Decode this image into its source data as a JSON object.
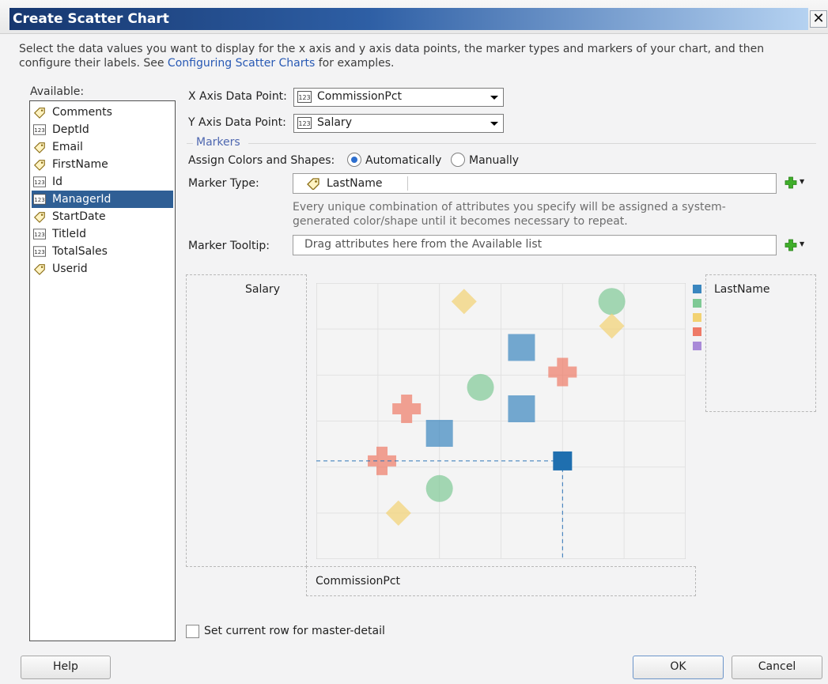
{
  "dialog": {
    "title": "Create Scatter Chart",
    "close_glyph": "✕",
    "description_before_link": "Select the data values you want to display for the x axis and y axis data points, the marker types and markers of your chart, and then configure their labels. See",
    "description_link": "Configuring Scatter Charts",
    "description_after_link": "for examples."
  },
  "available": {
    "label": "Available:",
    "selected_index": 5,
    "items": [
      {
        "label": "Comments",
        "icon": "tag-icon"
      },
      {
        "label": "DeptId",
        "icon": "number-icon"
      },
      {
        "label": "Email",
        "icon": "tag-icon"
      },
      {
        "label": "FirstName",
        "icon": "tag-icon"
      },
      {
        "label": "Id",
        "icon": "number-icon"
      },
      {
        "label": "ManagerId",
        "icon": "number-icon"
      },
      {
        "label": "StartDate",
        "icon": "tag-icon"
      },
      {
        "label": "TitleId",
        "icon": "number-icon"
      },
      {
        "label": "TotalSales",
        "icon": "number-icon"
      },
      {
        "label": "Userid",
        "icon": "tag-icon"
      }
    ]
  },
  "fields": {
    "x_axis": {
      "label": "X Axis Data Point:",
      "value": "CommissionPct"
    },
    "y_axis": {
      "label": "Y Axis Data Point:",
      "value": "Salary"
    },
    "markers_section": "Markers",
    "assign_label": "Assign Colors and Shapes:",
    "assign_options": [
      "Automatically",
      "Manually"
    ],
    "assign_selected": "Automatically",
    "marker_type": {
      "label": "Marker Type:",
      "value": "LastName"
    },
    "marker_type_hint": "Every unique combination of attributes you specify will be assigned a system-generated color/shape until it becomes necessary to repeat.",
    "marker_tooltip": {
      "label": "Marker Tooltip:",
      "placeholder": "Drag attributes here from the Available list"
    }
  },
  "preview": {
    "y_axis_label": "Salary",
    "x_axis_label": "CommissionPct",
    "legend_title": "LastName",
    "legend_colors": [
      "#3a86bf",
      "#7fc995",
      "#f2d272",
      "#ee7a67",
      "#a98ad8"
    ]
  },
  "chart_data": {
    "type": "scatter",
    "xlabel": "CommissionPct",
    "ylabel": "Salary",
    "legend_title": "LastName",
    "grid": true,
    "xlim": [
      0,
      9
    ],
    "ylim": [
      0,
      9
    ],
    "points": [
      {
        "x": 3.6,
        "y": 8.4,
        "shape": "diamond",
        "color": "#f2d272"
      },
      {
        "x": 7.2,
        "y": 8.4,
        "shape": "circle",
        "color": "#7fc995"
      },
      {
        "x": 7.2,
        "y": 7.6,
        "shape": "diamond",
        "color": "#f2d272"
      },
      {
        "x": 5.0,
        "y": 6.9,
        "shape": "square",
        "color": "#3a86bf"
      },
      {
        "x": 6.0,
        "y": 6.1,
        "shape": "cross",
        "color": "#ee7a67"
      },
      {
        "x": 4.0,
        "y": 5.6,
        "shape": "circle",
        "color": "#7fc995"
      },
      {
        "x": 5.0,
        "y": 4.9,
        "shape": "square",
        "color": "#3a86bf"
      },
      {
        "x": 2.2,
        "y": 4.9,
        "shape": "cross",
        "color": "#ee7a67"
      },
      {
        "x": 3.0,
        "y": 4.1,
        "shape": "square",
        "color": "#3a86bf"
      },
      {
        "x": 1.6,
        "y": 3.2,
        "shape": "cross",
        "color": "#ee7a67"
      },
      {
        "x": 6.0,
        "y": 3.2,
        "shape": "square",
        "color": "#1f6faf",
        "highlighted": true
      },
      {
        "x": 3.0,
        "y": 2.3,
        "shape": "circle",
        "color": "#7fc995"
      },
      {
        "x": 2.0,
        "y": 1.5,
        "shape": "diamond",
        "color": "#f2d272"
      }
    ]
  },
  "footer": {
    "master_detail_label": "Set current row for master-detail",
    "master_detail_checked": false,
    "help": "Help",
    "ok": "OK",
    "cancel": "Cancel"
  }
}
